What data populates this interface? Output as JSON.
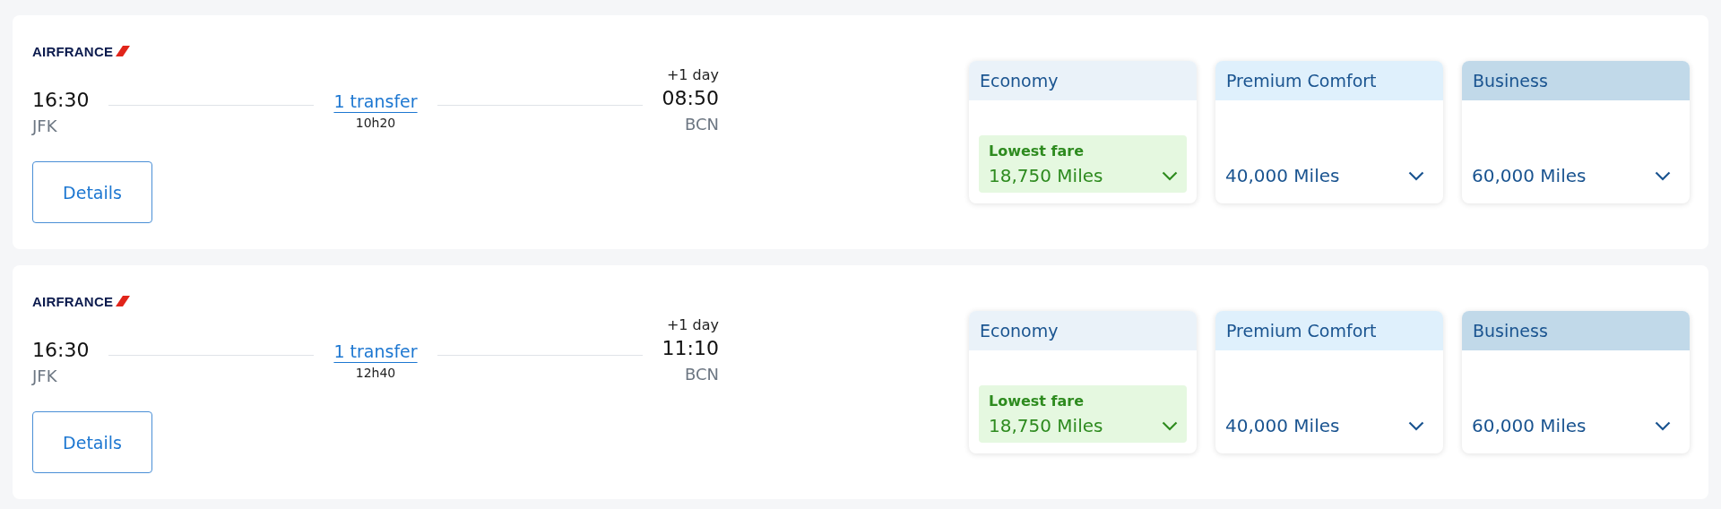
{
  "flights": [
    {
      "airline": "AIRFRANCE",
      "departure": {
        "time": "16:30",
        "airport": "JFK"
      },
      "transfer": "1 transfer",
      "duration": "10h20",
      "day_offset": "+1 day",
      "arrival": {
        "time": "08:50",
        "airport": "BCN"
      },
      "details_button": "Details",
      "fares": [
        {
          "cabin": "Economy",
          "color": "#eaf2f9",
          "badge": "Lowest fare",
          "price": "18,750 Miles",
          "highlighted": true
        },
        {
          "cabin": "Premium Comfort",
          "color": "#dff0fc",
          "price": "40,000 Miles",
          "highlighted": false
        },
        {
          "cabin": "Business",
          "color": "#c1d9e9",
          "price": "60,000 Miles",
          "highlighted": false
        }
      ]
    },
    {
      "airline": "AIRFRANCE",
      "departure": {
        "time": "16:30",
        "airport": "JFK"
      },
      "transfer": "1 transfer",
      "duration": "12h40",
      "day_offset": "+1 day",
      "arrival": {
        "time": "11:10",
        "airport": "BCN"
      },
      "details_button": "Details",
      "fares": [
        {
          "cabin": "Economy",
          "color": "#eaf2f9",
          "badge": "Lowest fare",
          "price": "18,750 Miles",
          "highlighted": true
        },
        {
          "cabin": "Premium Comfort",
          "color": "#dff0fc",
          "price": "40,000 Miles",
          "highlighted": false
        },
        {
          "cabin": "Business",
          "color": "#c1d9e9",
          "price": "60,000 Miles",
          "highlighted": false
        }
      ]
    }
  ]
}
